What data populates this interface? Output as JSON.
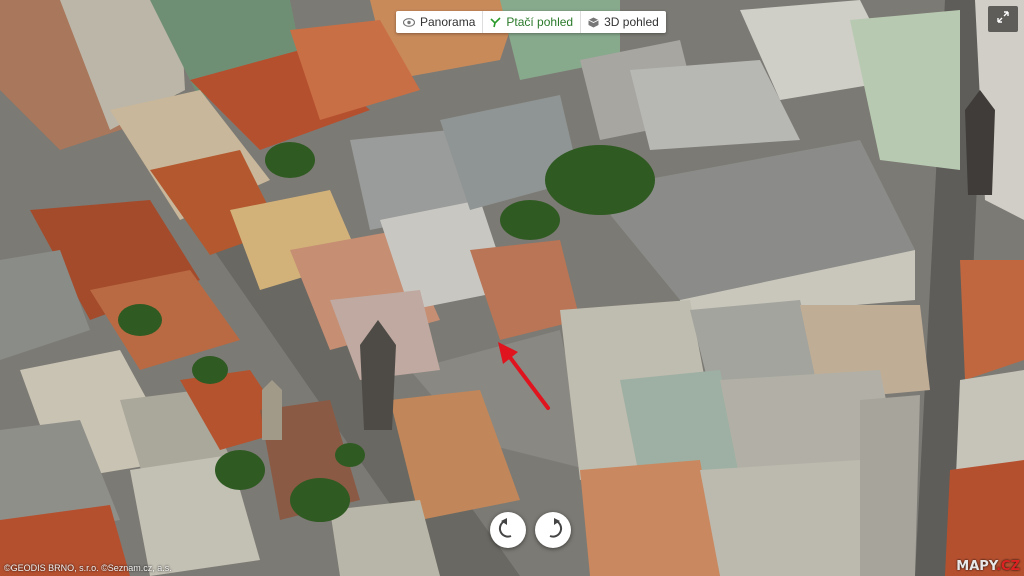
{
  "view_modes": [
    {
      "label": "Panorama",
      "icon": "eye-icon",
      "active": false
    },
    {
      "label": "Ptačí pohled",
      "icon": "bird-icon",
      "active": true
    },
    {
      "label": "3D pohled",
      "icon": "cube-icon",
      "active": false
    }
  ],
  "controls": {
    "fullscreen_icon": "expand-icon",
    "rotate_left_icon": "rotate-left-icon",
    "rotate_right_icon": "rotate-right-icon"
  },
  "map": {
    "imagery": "aerial oblique view of city blocks",
    "marker_icon": "red-arrow-icon",
    "marker_color": "#e0141e"
  },
  "footer": {
    "copyright": "©GEODIS BRNO, s.r.o. ©Seznam.cz, a.s.",
    "logo_prefix": "MAPY",
    "logo_suffix": ".CZ"
  },
  "colors": {
    "active_mode": "#2a7a2a",
    "roof_red": "#b5502f",
    "roof_gray": "#8e8f8c",
    "tree_green": "#2f5a22"
  }
}
